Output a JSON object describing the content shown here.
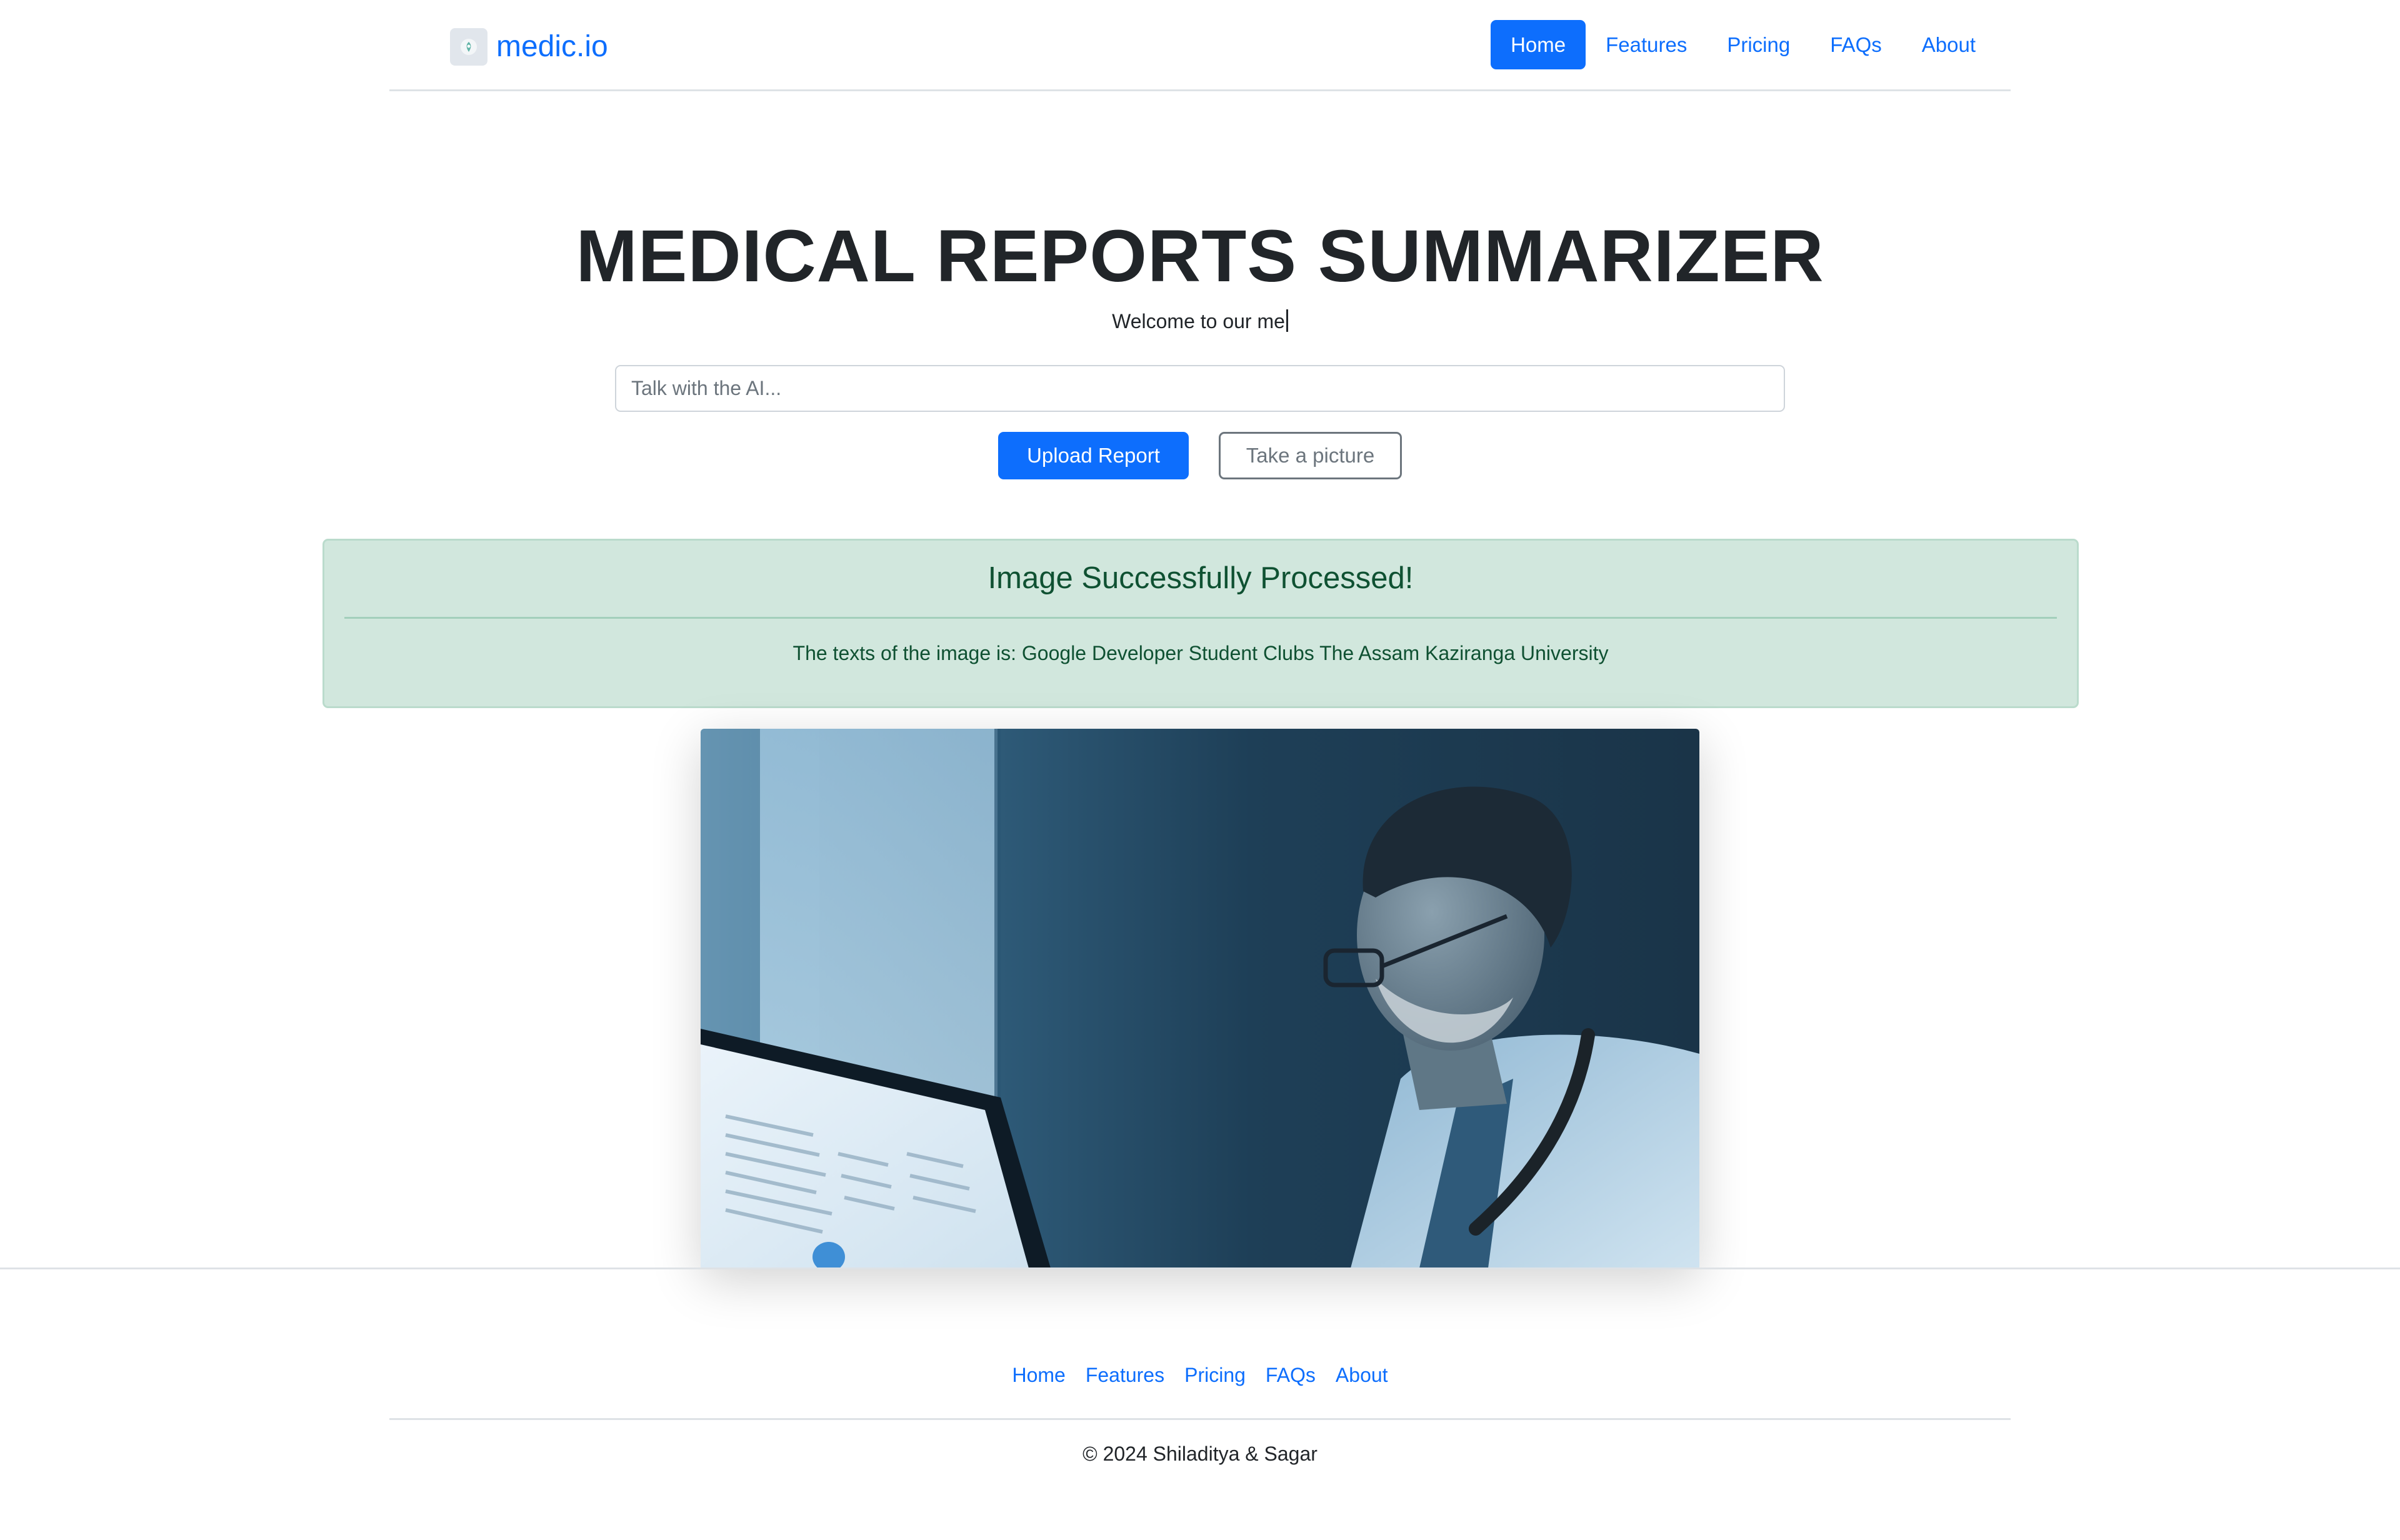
{
  "header": {
    "brand_name": "medic.io",
    "nav": [
      {
        "label": "Home",
        "active": true
      },
      {
        "label": "Features",
        "active": false
      },
      {
        "label": "Pricing",
        "active": false
      },
      {
        "label": "FAQs",
        "active": false
      },
      {
        "label": "About",
        "active": false
      }
    ]
  },
  "hero": {
    "title": "MEDICAL REPORTS SUMMARIZER",
    "subtitle": "Welcome to our me",
    "search_placeholder": "Talk with the AI...",
    "search_value": "",
    "upload_label": "Upload Report",
    "picture_label": "Take a picture"
  },
  "alert": {
    "heading": "Image Successfully Processed!",
    "body": "The texts of the image is: Google Developer Student Clubs The Assam Kaziranga University"
  },
  "footer": {
    "links": [
      "Home",
      "Features",
      "Pricing",
      "FAQs",
      "About"
    ],
    "copyright": "© 2024 Shiladitya & Sagar"
  },
  "colors": {
    "primary": "#0d6efd",
    "alert_bg": "#d1e7dd",
    "alert_text": "#0f5132",
    "secondary": "#6c757d"
  },
  "icons": {
    "brand": "medical-logo-icon"
  }
}
